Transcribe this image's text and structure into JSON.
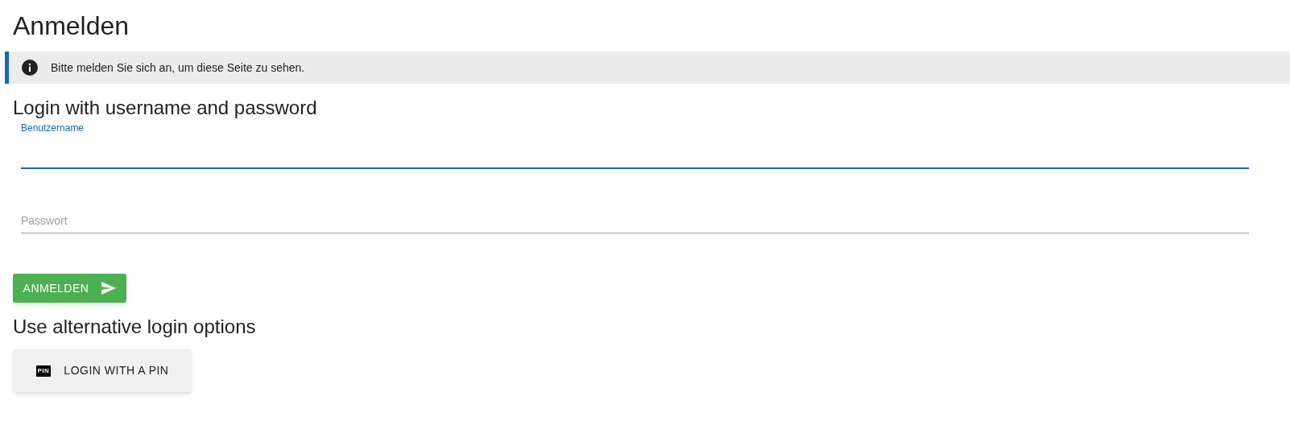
{
  "title": "Anmelden",
  "alert": {
    "text": "Bitte melden Sie sich an, um diese Seite zu sehen."
  },
  "login_section": {
    "heading": "Login with username and password",
    "fields": [
      {
        "label": "Benutzername",
        "focused": true
      },
      {
        "label": "Passwort",
        "focused": false
      }
    ],
    "submit_button": "ANMELDEN"
  },
  "alternative_section": {
    "heading": "Use alternative login options",
    "pin_button": {
      "icon_text": "PIN",
      "label": "LOGIN WITH A PIN"
    }
  }
}
